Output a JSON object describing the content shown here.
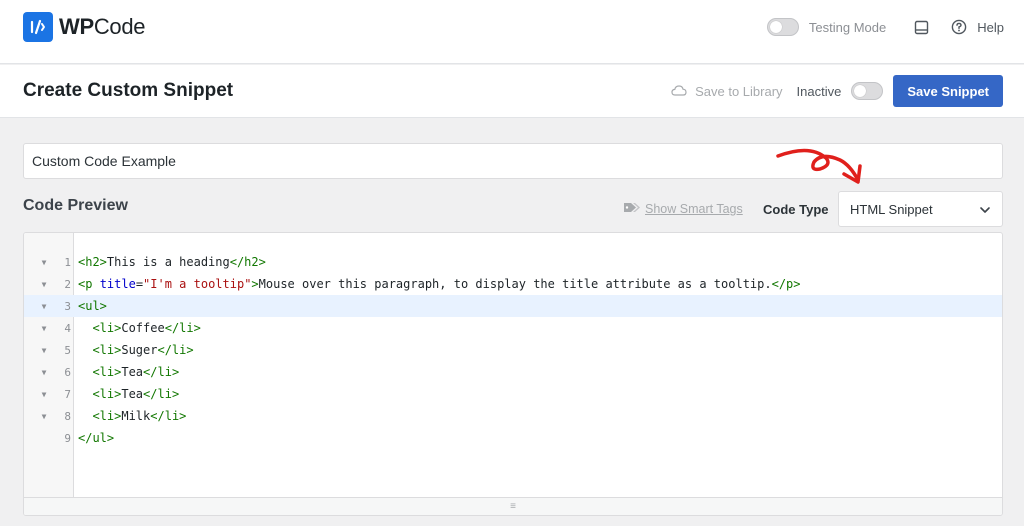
{
  "app": {
    "logo_wp": "WP",
    "logo_code": "Code",
    "testing_mode_label": "Testing Mode",
    "help_label": "Help"
  },
  "header": {
    "title": "Create Custom Snippet",
    "save_to_library": "Save to Library",
    "status_label": "Inactive",
    "save_button": "Save Snippet"
  },
  "snippet": {
    "title_value": "Custom Code Example"
  },
  "code_preview": {
    "label": "Code Preview",
    "smart_tags_link": "Show Smart Tags",
    "code_type_label": "Code Type",
    "code_type_selected": "HTML Snippet",
    "lines": [
      {
        "num": "1",
        "fold": true
      },
      {
        "num": "2",
        "fold": true
      },
      {
        "num": "3",
        "fold": true
      },
      {
        "num": "4",
        "fold": true
      },
      {
        "num": "5",
        "fold": true
      },
      {
        "num": "6",
        "fold": true
      },
      {
        "num": "7",
        "fold": true
      },
      {
        "num": "8",
        "fold": true
      },
      {
        "num": "9",
        "fold": false
      }
    ],
    "code": {
      "l1_open": "<h2>",
      "l1_text": "This is a heading",
      "l1_close": "</h2>",
      "l2_open": "<p",
      "l2_attr": "title",
      "l2_eq": "=",
      "l2_str": "\"I'm a tooltip\"",
      "l2_gt": ">",
      "l2_text": "Mouse over this paragraph, to display the title attribute as a tooltip.",
      "l2_close": "</p>",
      "l3": "<ul>",
      "l4_open": "<li>",
      "l4_text": "Coffee",
      "l4_close": "</li>",
      "l5_open": "<li>",
      "l5_text": "Suger",
      "l5_close": "</li>",
      "l6_open": "<li>",
      "l6_text": "Tea",
      "l6_close": "</li>",
      "l7_open": "<li>",
      "l7_text": "Tea",
      "l7_close": "</li>",
      "l8_open": "<li>",
      "l8_text": "Milk",
      "l8_close": "</li>",
      "l9": "</ul>"
    },
    "active_line": "3"
  },
  "colors": {
    "accent": "#3567c6",
    "brand": "#1b74e4",
    "tag": "#117700",
    "attribute": "#0000cc",
    "string": "#aa1111",
    "annotation_arrow": "#e0201c"
  },
  "icons": {
    "logo": "wpcode-logo-icon",
    "toggle": "toggle-icon",
    "screen_options": "screen-options-icon",
    "help": "help-circle-icon",
    "cloud": "cloud-icon",
    "tag": "tag-icon",
    "chevron": "chevron-down-icon",
    "fold": "fold-triangle-icon",
    "resize": "resize-handle-icon"
  }
}
